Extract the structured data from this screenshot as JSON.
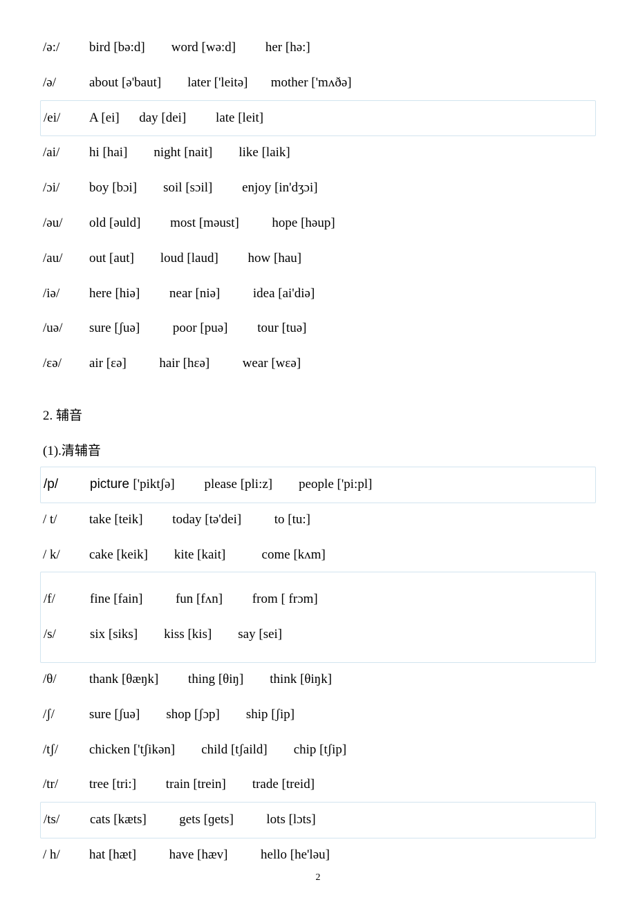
{
  "rows1": [
    {
      "sym": "/ə:/",
      "examples": "bird [bə:d]        word [wə:d]         her [hə:]",
      "boxed": false
    },
    {
      "sym": "/ə/",
      "examples": "about [ə'baut]        later ['leitə]       mother ['mʌðə]",
      "boxed": false
    },
    {
      "sym": "/ei/",
      "examples": "A [ei]      day [dei]         late [leit]",
      "boxed": true
    },
    {
      "sym": "/ai/",
      "examples": "hi [hai]        night [nait]        like [laik]",
      "boxed": false
    },
    {
      "sym": "/ɔi/",
      "examples": "boy [bɔi]        soil [sɔil]         enjoy [in'dʒɔi]",
      "boxed": false
    },
    {
      "sym": "/əu/",
      "examples": "old [əuld]         most [məust]          hope [həup]",
      "boxed": false
    },
    {
      "sym": "/au/",
      "examples": "out [aut]        loud [laud]         how [hau]",
      "boxed": false
    },
    {
      "sym": "/iə/",
      "examples": "here [hiə]         near [niə]          idea [ai'diə]",
      "boxed": false
    },
    {
      "sym": "/uə/",
      "examples": "sure [ʃuə]          poor [puə]         tour [tuə]",
      "boxed": false
    },
    {
      "sym": "/ɛə/",
      "examples": "air [ɛə]          hair [hɛə]          wear [wɛə]",
      "boxed": false
    }
  ],
  "section2_num": "2. 辅音",
  "section2_sub": "(1).清辅音",
  "rows2": [
    {
      "sym": "/p/",
      "first": "picture ",
      "first_ipa": "['piktʃə]",
      "rest": "         please [pli:z]        people ['pi:pl]",
      "boxed": true,
      "sans_first": true
    },
    {
      "sym": "/ t/",
      "examples": "take [teik]         today [tə'dei]          to [tu:]",
      "boxed": false
    },
    {
      "sym": "/ k/",
      "examples": "cake [keik]        kite [kait]           come [kʌm]",
      "boxed": false
    },
    {
      "sym": "/f/",
      "examples": "fine [fain]          fun [fʌn]         from [ frɔm]",
      "boxed": true
    },
    {
      "sym": "/s/",
      "examples": "six [siks]        kiss [kis]        say [sei]",
      "boxed": true,
      "stack": true
    },
    {
      "sym": "/θ/",
      "examples": "thank [θæŋk]         thing [θiŋ]        think [θiŋk]",
      "boxed": false
    },
    {
      "sym": "/ʃ/",
      "examples": "sure [ʃuə]        shop [ʃɔp]        ship [ʃip]",
      "boxed": false
    },
    {
      "sym": "/tʃ/",
      "examples": "chicken ['tʃikən]        child [tʃaild]        chip [tʃip]",
      "boxed": false
    },
    {
      "sym": "/tr/",
      "examples": "tree [tri:]         train [trein]        trade [treid]",
      "boxed": false
    },
    {
      "sym": "/ts/",
      "examples": "cats [kæts]          gets [ɡets]          lots [lɔts]",
      "boxed": true
    },
    {
      "sym": "/ h/",
      "examples": "hat [hæt]          have [hæv]          hello [he'ləu]",
      "boxed": false
    }
  ],
  "page_number": "2"
}
